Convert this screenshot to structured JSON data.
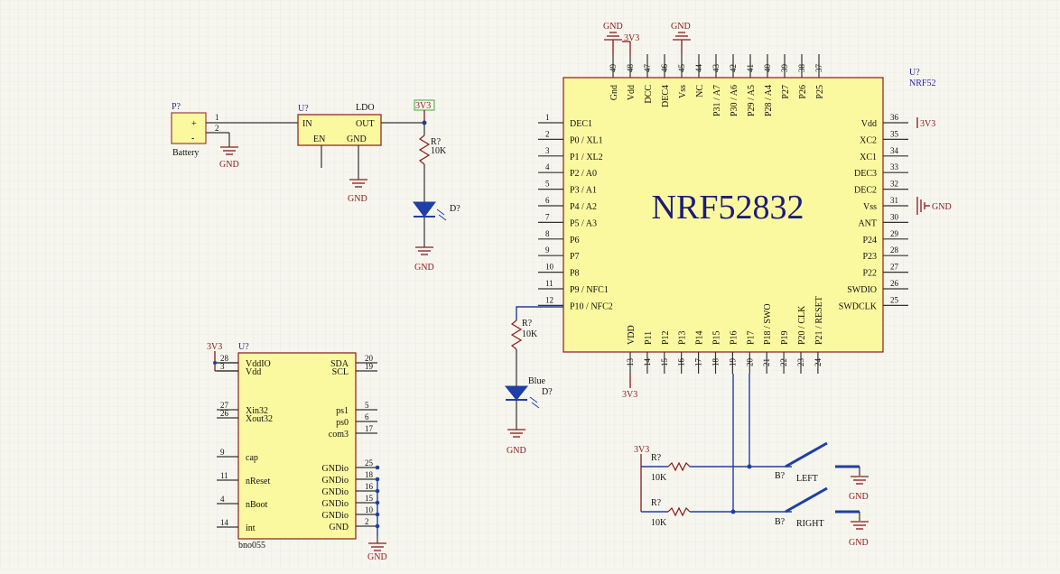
{
  "battery": {
    "designator": "P?",
    "comment": "Battery",
    "plus": "+",
    "minus": "-",
    "pin1": "1",
    "pin2": "2",
    "gnd": "GND"
  },
  "ldo": {
    "designator": "U?",
    "comment": "LDO",
    "pin_in": "IN",
    "pin_out": "OUT",
    "pin_en": "EN",
    "pin_gnd": "GND",
    "gnd": "GND"
  },
  "power_led": {
    "rail": "3V3",
    "resistor_designator": "R?",
    "resistor_value": "10K",
    "led_designator": "D?",
    "gnd": "GND"
  },
  "nrf": {
    "designator": "U?",
    "comment": "NRF52",
    "title": "NRF52832",
    "top_power": {
      "gnd": "GND",
      "v33": "3V3",
      "gnd2": "GND"
    },
    "left_pins": [
      {
        "num": "1",
        "name": "DEC1"
      },
      {
        "num": "2",
        "name": "P0 / XL1"
      },
      {
        "num": "3",
        "name": "P1 / XL2"
      },
      {
        "num": "4",
        "name": "P2 / A0"
      },
      {
        "num": "5",
        "name": "P3 / A1"
      },
      {
        "num": "6",
        "name": "P4 / A2"
      },
      {
        "num": "7",
        "name": "P5 / A3"
      },
      {
        "num": "8",
        "name": "P6"
      },
      {
        "num": "9",
        "name": "P7"
      },
      {
        "num": "10",
        "name": "P8"
      },
      {
        "num": "11",
        "name": "P9 / NFC1"
      },
      {
        "num": "12",
        "name": "P10 / NFC2"
      }
    ],
    "right_pins": [
      {
        "num": "36",
        "name": "Vdd"
      },
      {
        "num": "35",
        "name": "XC2"
      },
      {
        "num": "34",
        "name": "XC1"
      },
      {
        "num": "33",
        "name": "DEC3"
      },
      {
        "num": "32",
        "name": "DEC2"
      },
      {
        "num": "31",
        "name": "Vss"
      },
      {
        "num": "30",
        "name": "ANT"
      },
      {
        "num": "29",
        "name": "P24"
      },
      {
        "num": "28",
        "name": "P23"
      },
      {
        "num": "27",
        "name": "P22"
      },
      {
        "num": "26",
        "name": "SWDIO"
      },
      {
        "num": "25",
        "name": "SWDCLK"
      }
    ],
    "top_pins": [
      {
        "num": "49",
        "name": "Gnd"
      },
      {
        "num": "48",
        "name": "Vdd"
      },
      {
        "num": "47",
        "name": "DCC"
      },
      {
        "num": "46",
        "name": "DEC4"
      },
      {
        "num": "45",
        "name": "Vss"
      },
      {
        "num": "44",
        "name": "NC"
      },
      {
        "num": "43",
        "name": "P31 / A7"
      },
      {
        "num": "42",
        "name": "P30 / A6"
      },
      {
        "num": "41",
        "name": "P29 / A5"
      },
      {
        "num": "40",
        "name": "P28 / A4"
      },
      {
        "num": "39",
        "name": "P27"
      },
      {
        "num": "38",
        "name": "P26"
      },
      {
        "num": "37",
        "name": "P25"
      }
    ],
    "bottom_pins": [
      {
        "num": "13",
        "name": "VDD"
      },
      {
        "num": "14",
        "name": "P11"
      },
      {
        "num": "15",
        "name": "P12"
      },
      {
        "num": "16",
        "name": "P13"
      },
      {
        "num": "17",
        "name": "P14"
      },
      {
        "num": "18",
        "name": "P15"
      },
      {
        "num": "19",
        "name": "P16"
      },
      {
        "num": "20",
        "name": "P17"
      },
      {
        "num": "21",
        "name": "P18 / SWO"
      },
      {
        "num": "22",
        "name": "P19"
      },
      {
        "num": "23",
        "name": "P20 / CLK"
      },
      {
        "num": "24",
        "name": "P21 / RESET"
      }
    ],
    "right_power": {
      "v33": "3V3",
      "gnd": "GND"
    },
    "bottom_power": {
      "v33": "3V3"
    }
  },
  "blue_led": {
    "resistor_designator": "R?",
    "resistor_value": "10K",
    "color_label": "Blue",
    "led_designator": "D?",
    "gnd": "GND"
  },
  "bno": {
    "designator": "U?",
    "comment": "bno055",
    "rail": "3V3",
    "left_pins": [
      {
        "num": "28",
        "name": "VddIO"
      },
      {
        "num": "3",
        "name": "Vdd"
      },
      {
        "num": "27",
        "name": "Xin32"
      },
      {
        "num": "26",
        "name": "Xout32"
      },
      {
        "num": "9",
        "name": "cap"
      },
      {
        "num": "11",
        "name": "nReset"
      },
      {
        "num": "4",
        "name": "nBoot"
      },
      {
        "num": "14",
        "name": "int"
      }
    ],
    "right_pins": [
      {
        "num": "20",
        "name": "SDA"
      },
      {
        "num": "19",
        "name": "SCL"
      },
      {
        "num": "5",
        "name": "ps1"
      },
      {
        "num": "6",
        "name": "ps0"
      },
      {
        "num": "17",
        "name": "com3"
      },
      {
        "num": "25",
        "name": "GNDio"
      },
      {
        "num": "18",
        "name": "GNDio"
      },
      {
        "num": "16",
        "name": "GNDio"
      },
      {
        "num": "15",
        "name": "GNDio"
      },
      {
        "num": "10",
        "name": "GNDio"
      },
      {
        "num": "2",
        "name": "GND"
      }
    ],
    "gnd": "GND"
  },
  "buttons": {
    "rail": "3V3",
    "r1_designator": "R?",
    "r1_value": "10K",
    "r2_designator": "R?",
    "r2_value": "10K",
    "b1_designator": "B?",
    "b1_label": "LEFT",
    "b1_gnd": "GND",
    "b2_designator": "B?",
    "b2_label": "RIGHT",
    "b2_gnd": "GND"
  },
  "colors": {
    "background": "#f6f6ef",
    "grid": "#e4e4d6",
    "chip_fill": "#fbf99f",
    "wire": "#1f3fa6",
    "power": "#8b1a1a",
    "title": "#1c1c7a"
  }
}
